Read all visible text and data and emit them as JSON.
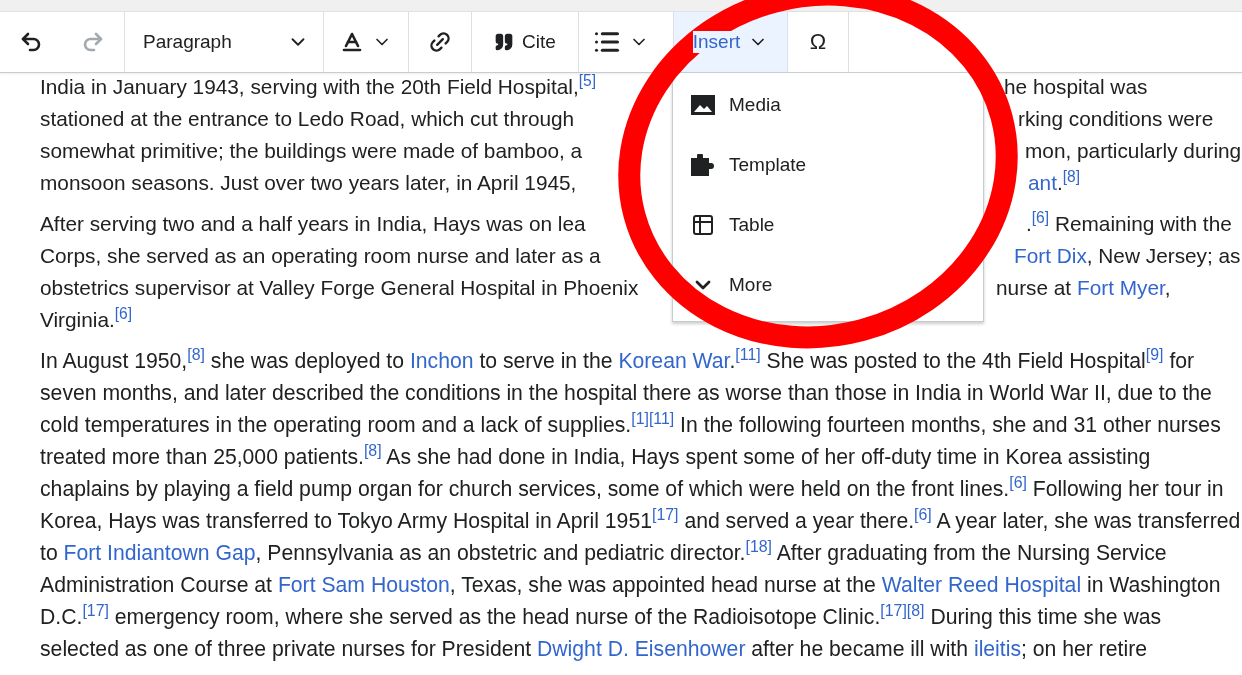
{
  "toolbar": {
    "undo": {
      "disabled": false
    },
    "redo": {
      "disabled": true
    },
    "format": {
      "label": "Paragraph"
    },
    "cite": {
      "label": "Cite"
    },
    "insert": {
      "label": "Insert",
      "selected": true
    },
    "special_character": {
      "label": "Ω"
    }
  },
  "insert_menu": {
    "items": [
      {
        "kind": "media",
        "label": "Media"
      },
      {
        "kind": "template",
        "label": "Template"
      },
      {
        "kind": "table",
        "label": "Table"
      },
      {
        "kind": "more",
        "label": "More"
      }
    ]
  },
  "split_paragraphs": [
    {
      "lines": [
        {
          "left": [
            {
              "kind": "text",
              "text": "India in January 1943, serving with the 20th Field Hospital,"
            },
            {
              "kind": "ref",
              "text": "[5]"
            }
          ],
          "right": [
            {
              "kind": "text",
              "text": "he hospital was"
            }
          ]
        },
        {
          "left": [
            {
              "kind": "text",
              "text": "stationed at the entrance to Ledo Road, which cut through"
            }
          ],
          "right": [
            {
              "kind": "text",
              "text": "rking conditions were"
            }
          ]
        },
        {
          "left": [
            {
              "kind": "text",
              "text": "somewhat primitive; the buildings were made of bamboo, a"
            }
          ],
          "right": [
            {
              "kind": "text",
              "text": "mon, particularly during"
            }
          ]
        },
        {
          "left": [
            {
              "kind": "text",
              "text": "monsoon seasons. Just over two years later, in April 1945,"
            }
          ],
          "right": [
            {
              "kind": "link",
              "text": "ant"
            },
            {
              "kind": "text",
              "text": "."
            },
            {
              "kind": "ref",
              "text": "[8]"
            }
          ]
        }
      ]
    },
    {
      "lines": [
        {
          "left": [
            {
              "kind": "text",
              "text": "After serving two and a half years in India, Hays was on lea"
            }
          ],
          "right": [
            {
              "kind": "text",
              "text": "."
            },
            {
              "kind": "ref",
              "text": "[6]"
            },
            {
              "kind": "text",
              "text": " Remaining with the"
            }
          ]
        },
        {
          "left": [
            {
              "kind": "text",
              "text": "Corps, she served as an operating room nurse and later as a"
            }
          ],
          "right": [
            {
              "kind": "link",
              "text": "Fort Dix"
            },
            {
              "kind": "text",
              "text": ", New Jersey; as"
            }
          ]
        },
        {
          "left": [
            {
              "kind": "text",
              "text": "obstetrics supervisor at Valley Forge General Hospital in Phoenix"
            }
          ],
          "right": [
            {
              "kind": "text",
              "text": "nurse at "
            },
            {
              "kind": "link",
              "text": "Fort Myer"
            },
            {
              "kind": "text",
              "text": ","
            }
          ]
        },
        {
          "left": [
            {
              "kind": "text",
              "text": "Virginia."
            },
            {
              "kind": "ref",
              "text": "[6]"
            }
          ]
        }
      ]
    }
  ],
  "paragraphs": [
    {
      "segments": [
        {
          "kind": "text",
          "text": "In August 1950,"
        },
        {
          "kind": "ref",
          "text": "[8]"
        },
        {
          "kind": "text",
          "text": " she was deployed to "
        },
        {
          "kind": "link",
          "text": "Inchon"
        },
        {
          "kind": "text",
          "text": " to serve in the "
        },
        {
          "kind": "link",
          "text": "Korean War"
        },
        {
          "kind": "text",
          "text": "."
        },
        {
          "kind": "ref",
          "text": "[11]"
        },
        {
          "kind": "text",
          "text": " She was posted to the 4th Field Hospital"
        },
        {
          "kind": "ref",
          "text": "[9]"
        },
        {
          "kind": "text",
          "text": " for seven months, and later described the conditions in the hospital there as worse than those in India in World War II, due to the cold temperatures in the operating room and a lack of supplies."
        },
        {
          "kind": "ref",
          "text": "[1]"
        },
        {
          "kind": "ref",
          "text": "[11]"
        },
        {
          "kind": "text",
          "text": " In the following fourteen months, she and 31 other nurses treated more than 25,000 patients."
        },
        {
          "kind": "ref",
          "text": "[8]"
        },
        {
          "kind": "text",
          "text": " As she had done in India, Hays spent some of her off-duty time in Korea assisting chaplains by playing a field pump organ for church services, some of which were held on the front lines."
        },
        {
          "kind": "ref",
          "text": "[6]"
        },
        {
          "kind": "text",
          "text": " Following her tour in Korea, Hays was transferred to Tokyo Army Hospital in April 1951"
        },
        {
          "kind": "ref",
          "text": "[17]"
        },
        {
          "kind": "text",
          "text": " and served a year there."
        },
        {
          "kind": "ref",
          "text": "[6]"
        },
        {
          "kind": "text",
          "text": " A year later, she was transferred to "
        },
        {
          "kind": "link",
          "text": "Fort Indiantown Gap"
        },
        {
          "kind": "text",
          "text": ", Pennsylvania as an obstetric and pediatric director."
        },
        {
          "kind": "ref",
          "text": "[18]"
        },
        {
          "kind": "text",
          "text": " After graduating from the Nursing Service Administration Course at "
        },
        {
          "kind": "link",
          "text": "Fort Sam Houston"
        },
        {
          "kind": "text",
          "text": ", Texas, she was appointed head nurse at the "
        },
        {
          "kind": "link",
          "text": "Walter Reed Hospital"
        },
        {
          "kind": "text",
          "text": " in Washington D.C."
        },
        {
          "kind": "ref",
          "text": "[17]"
        },
        {
          "kind": "text",
          "text": " emergency room, where she served as the head nurse of the Radioisotope Clinic."
        },
        {
          "kind": "ref",
          "text": "[17]"
        },
        {
          "kind": "ref",
          "text": "[8]"
        },
        {
          "kind": "text",
          "text": " During this time she was selected as one of three private nurses for President "
        },
        {
          "kind": "link",
          "text": "Dwight D. Eisenhower"
        },
        {
          "kind": "text",
          "text": " after he became ill with "
        },
        {
          "kind": "link",
          "text": "ileitis"
        },
        {
          "kind": "text",
          "text": "; on her retire"
        }
      ]
    }
  ]
}
